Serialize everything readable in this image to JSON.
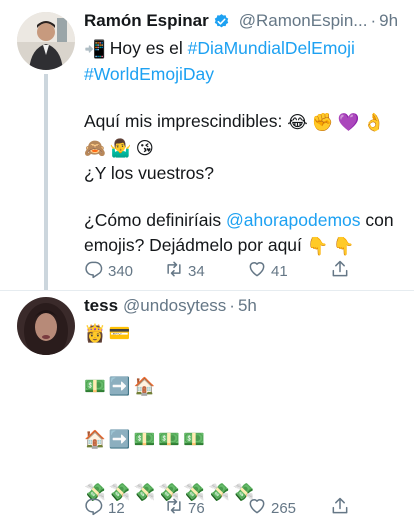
{
  "tweets": [
    {
      "name": "Ramón Espinar",
      "handle": "@RamonEspin...",
      "dot": "·",
      "time": "9h",
      "lines": {
        "l1_text": "Hoy es el ",
        "l1_hashtag": "#DiaMundialDelEmoji",
        "l2_hashtag": "#WorldEmojiDay",
        "l3": "Aquí mis imprescindibles:",
        "l5": "¿Y los vuestros?",
        "l6_text": "¿Cómo definiríais ",
        "l6_mention": "@ahorapodemos",
        "l6_end": " con",
        "l7": "emojis? Dejádmelo por aquí"
      },
      "emojis": {
        "phone": "📲",
        "line3": [
          "😂",
          "✊",
          "💜",
          "👌"
        ],
        "line4": [
          "🙈",
          "🤷‍♂️",
          "😘"
        ],
        "pointing": [
          "👇",
          "👇"
        ]
      },
      "counts": {
        "replies": "340",
        "retweets": "34",
        "likes": "41"
      }
    },
    {
      "name": "tess",
      "handle": "@undosytess",
      "dot": "·",
      "time": "5h",
      "emojis": {
        "row1": [
          "👸",
          "💳"
        ],
        "row2": [
          "💵",
          "➡️",
          "🏠"
        ],
        "row3": [
          "🏠",
          "➡️",
          "💵",
          "💵",
          "💵"
        ],
        "row4": [
          "💸",
          "💸",
          "💸",
          "💸",
          "💸",
          "💸",
          "💸"
        ]
      },
      "counts": {
        "replies": "12",
        "retweets": "76",
        "likes": "265"
      }
    }
  ],
  "icons": [
    "verified-badge-icon",
    "reply-icon",
    "retweet-icon",
    "like-icon",
    "share-icon"
  ],
  "colors": {
    "link": "#1da1f2",
    "muted": "#657786",
    "verified": "#1da1f2",
    "thread": "#ccd6dd"
  }
}
